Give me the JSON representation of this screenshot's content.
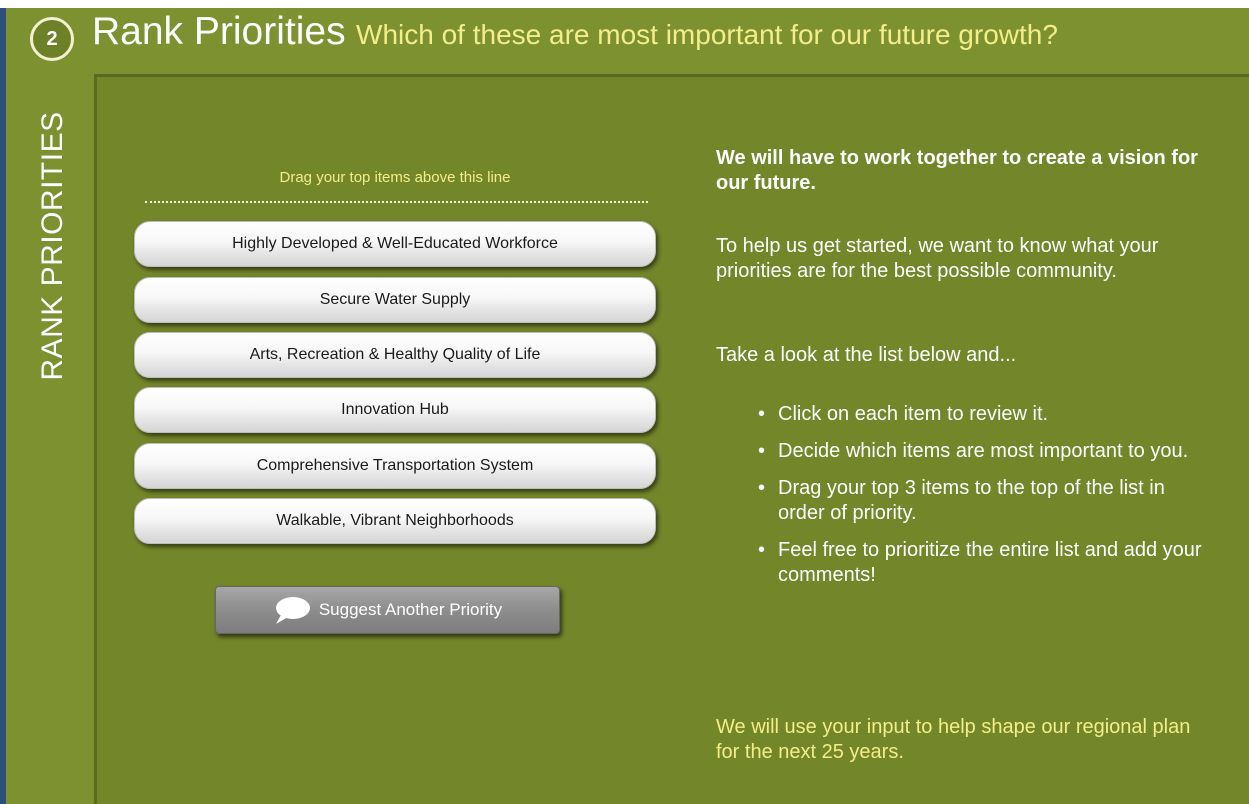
{
  "header": {
    "step_number": "2",
    "title": "Rank Priorities",
    "subtitle": "Which of these are most important for our future growth?"
  },
  "side_label": "RANK PRIORITIES",
  "ranking": {
    "drag_hint": "Drag your top items above this line",
    "items": [
      {
        "label": "Highly Developed & Well-Educated Workforce"
      },
      {
        "label": "Secure Water Supply"
      },
      {
        "label": "Arts, Recreation & Healthy Quality of Life"
      },
      {
        "label": "Innovation Hub"
      },
      {
        "label": "Comprehensive Transportation System"
      },
      {
        "label": "Walkable, Vibrant Neighborhoods"
      }
    ],
    "suggest_button": {
      "label": "Suggest Another Priority",
      "icon": "speech-bubble-icon"
    }
  },
  "instructions": {
    "lead": "We will have to work together to create a vision for our future.",
    "intro": "To help us get started, we want to know what your priorities are for the best possible community.",
    "prompt": "Take a look at the list below and...",
    "steps": [
      "Click on each item to review it.",
      "Decide which items are most important to you.",
      "Drag your top 3 items to the top of the list in order of priority.",
      "Feel free to prioritize the entire list and add your comments!"
    ],
    "closing": "We will use your input to help shape our regional plan for the next 25 years."
  },
  "colors": {
    "background": "#7e9130",
    "panel": "#74862a",
    "accent_yellow": "#f2ee8a",
    "left_border": "#2e4e7d"
  }
}
